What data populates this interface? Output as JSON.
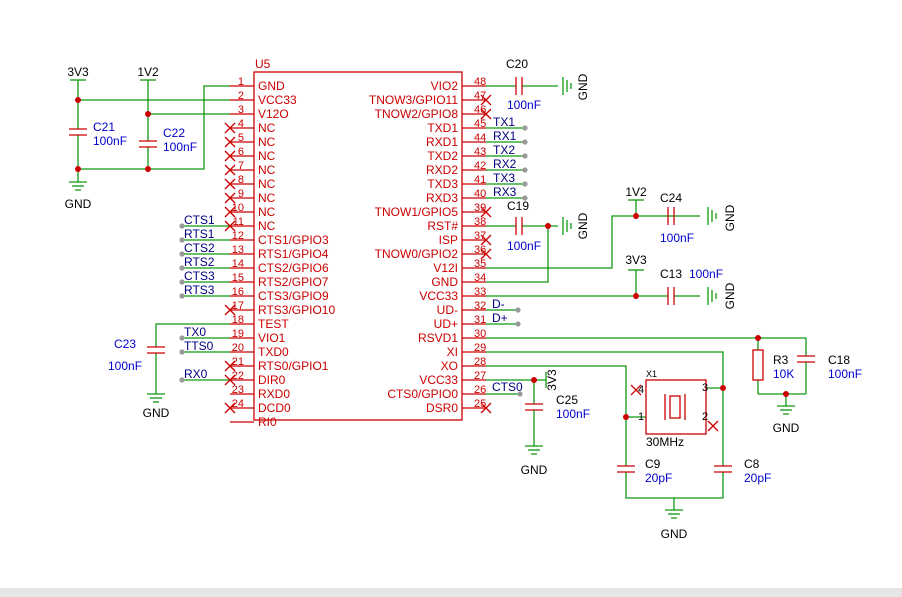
{
  "colors": {
    "wire": "#119911",
    "part": "#cc0000",
    "label": "#0000cc",
    "netlabel": "#000080",
    "junction": "#cc0000",
    "noconnect": "#cc0000",
    "gray": "#999999"
  },
  "chip": {
    "ref": "U5",
    "left_pins": [
      {
        "num": "1",
        "name": "GND"
      },
      {
        "num": "2",
        "name": "VCC33"
      },
      {
        "num": "3",
        "name": "V12O"
      },
      {
        "num": "4",
        "name": "NC"
      },
      {
        "num": "5",
        "name": "NC"
      },
      {
        "num": "6",
        "name": "NC"
      },
      {
        "num": "7",
        "name": "NC"
      },
      {
        "num": "8",
        "name": "NC"
      },
      {
        "num": "9",
        "name": "NC"
      },
      {
        "num": "10",
        "name": "NC"
      },
      {
        "num": "11",
        "name": "NC"
      },
      {
        "num": "12",
        "name": "CTS1/GPIO3"
      },
      {
        "num": "13",
        "name": "RTS1/GPIO4"
      },
      {
        "num": "14",
        "name": "CTS2/GPIO6"
      },
      {
        "num": "15",
        "name": "RTS2/GPIO7"
      },
      {
        "num": "16",
        "name": "CTS3/GPIO9"
      },
      {
        "num": "17",
        "name": "RTS3/GPIO10"
      },
      {
        "num": "18",
        "name": "TEST"
      },
      {
        "num": "19",
        "name": "VIO1"
      },
      {
        "num": "20",
        "name": "TXD0"
      },
      {
        "num": "21",
        "name": "RTS0/GPIO1"
      },
      {
        "num": "22",
        "name": "DIR0"
      },
      {
        "num": "23",
        "name": "RXD0"
      },
      {
        "num": "24",
        "name": "DCD0"
      },
      {
        "num": "",
        "name": "RI0"
      }
    ],
    "right_pins": [
      {
        "num": "48",
        "name": "VIO2"
      },
      {
        "num": "47",
        "name": "TNOW3/GPIO11"
      },
      {
        "num": "46",
        "name": "TNOW2/GPIO8"
      },
      {
        "num": "45",
        "name": "TXD1"
      },
      {
        "num": "44",
        "name": "RXD1"
      },
      {
        "num": "43",
        "name": "TXD2"
      },
      {
        "num": "42",
        "name": "RXD2"
      },
      {
        "num": "41",
        "name": "TXD3"
      },
      {
        "num": "40",
        "name": "RXD3"
      },
      {
        "num": "39",
        "name": "TNOW1/GPIO5"
      },
      {
        "num": "38",
        "name": "RST#"
      },
      {
        "num": "37",
        "name": "ISP"
      },
      {
        "num": "36",
        "name": "TNOW0/GPIO2"
      },
      {
        "num": "35",
        "name": "V12I"
      },
      {
        "num": "34",
        "name": "GND"
      },
      {
        "num": "33",
        "name": "VCC33"
      },
      {
        "num": "32",
        "name": "UD-"
      },
      {
        "num": "31",
        "name": "UD+"
      },
      {
        "num": "30",
        "name": "RSVD1"
      },
      {
        "num": "29",
        "name": "XI"
      },
      {
        "num": "28",
        "name": "XO"
      },
      {
        "num": "27",
        "name": "VCC33"
      },
      {
        "num": "26",
        "name": "CTS0/GPIO0"
      },
      {
        "num": "25",
        "name": "DSR0"
      }
    ]
  },
  "net_labels_left": [
    "CTS1",
    "RTS1",
    "CTS2",
    "RTS2",
    "CTS3",
    "RTS3",
    "TX0",
    "TTS0",
    "RX0"
  ],
  "net_labels_right": [
    "TX1",
    "RX1",
    "TX2",
    "RX2",
    "TX3",
    "RX3",
    "D-",
    "D+",
    "CTS0"
  ],
  "power": {
    "v3v3": "3V3",
    "v1v2": "1V2",
    "gnd": "GND"
  },
  "components": {
    "c21": {
      "ref": "C21",
      "value": "100nF"
    },
    "c22": {
      "ref": "C22",
      "value": "100nF"
    },
    "c23": {
      "ref": "C23",
      "value": "100nF"
    },
    "c20": {
      "ref": "C20",
      "value": "100nF"
    },
    "c19": {
      "ref": "C19",
      "value": "100nF"
    },
    "c24": {
      "ref": "C24",
      "value": "100nF"
    },
    "c13": {
      "ref": "C13",
      "value": "100nF"
    },
    "c25": {
      "ref": "C25",
      "value": "100nF"
    },
    "c18": {
      "ref": "C18",
      "value": "100nF"
    },
    "r3": {
      "ref": "R3",
      "value": "10K"
    },
    "c9": {
      "ref": "C9",
      "value": "20pF"
    },
    "c8": {
      "ref": "C8",
      "value": "20pF"
    },
    "x1": {
      "ref": "X1",
      "value": "30MHz",
      "pins": [
        "4",
        "3",
        "1",
        "2"
      ]
    }
  }
}
